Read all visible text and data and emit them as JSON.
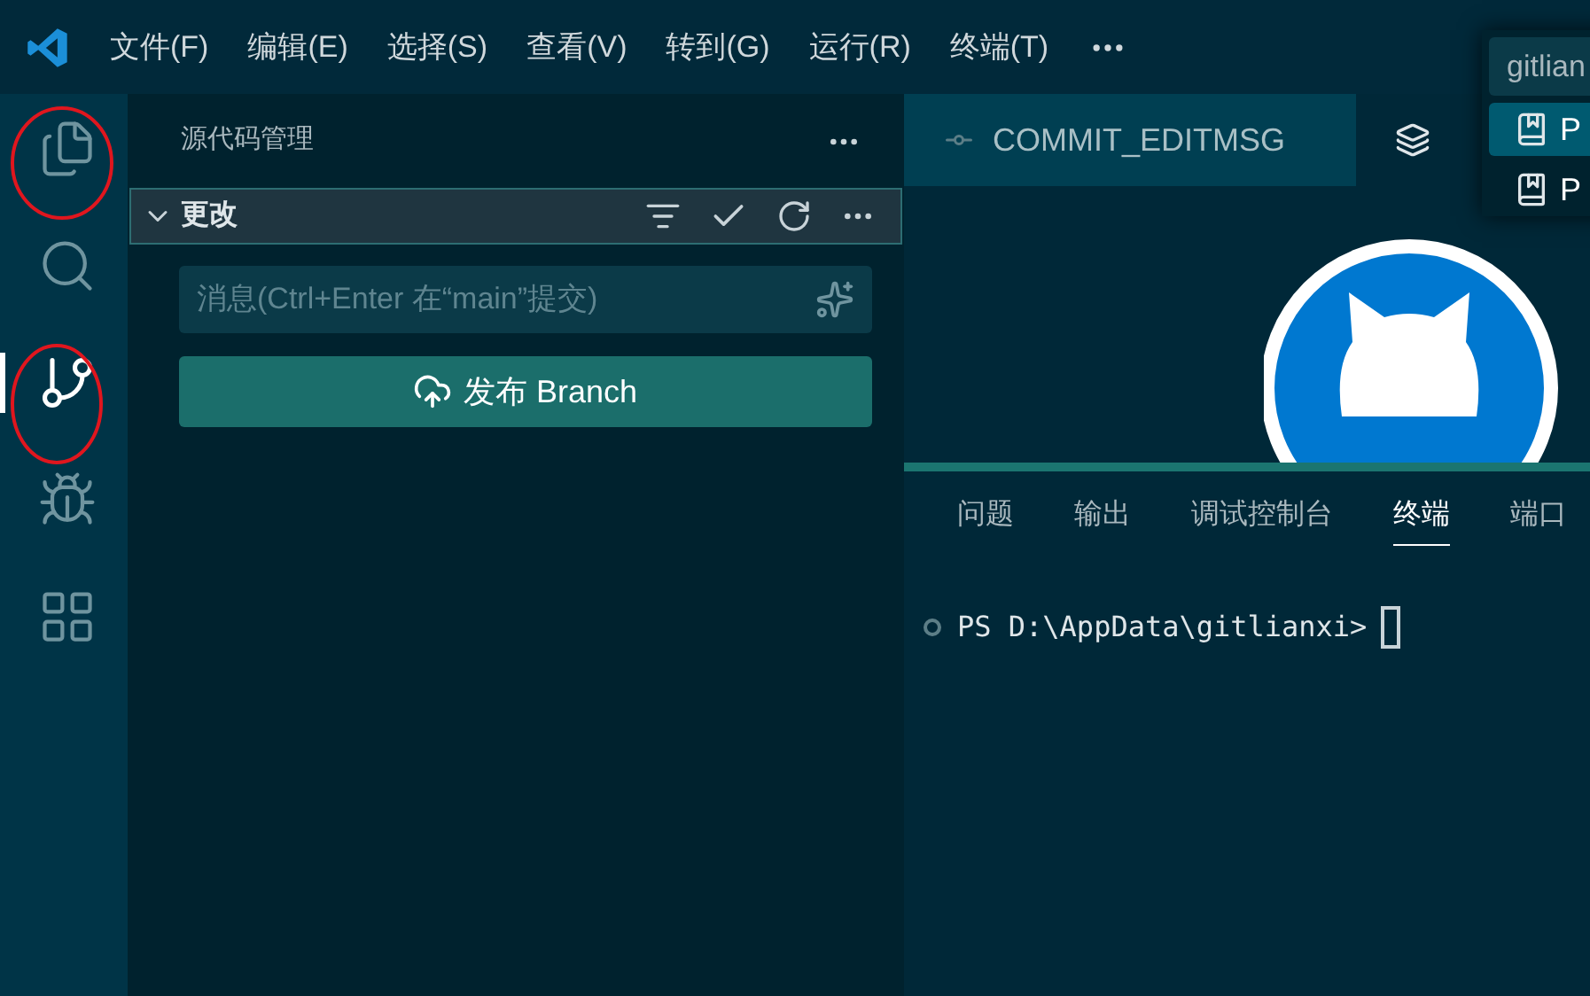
{
  "menu_bar": {
    "items": [
      "文件(F)",
      "编辑(E)",
      "选择(S)",
      "查看(V)",
      "转到(G)",
      "运行(R)",
      "终端(T)"
    ]
  },
  "activity_bar": {
    "items": [
      {
        "kind": "explorer",
        "selected": false
      },
      {
        "kind": "search",
        "selected": false
      },
      {
        "kind": "scm",
        "selected": true
      },
      {
        "kind": "debug",
        "selected": false
      },
      {
        "kind": "extensions",
        "selected": false
      }
    ]
  },
  "sidebar": {
    "title": "源代码管理",
    "section": {
      "title": "更改",
      "expanded": true
    },
    "message_field": {
      "placeholder": "消息(Ctrl+Enter 在“main”提交)"
    },
    "publish_button": "发布 Branch"
  },
  "editor_tabs": [
    {
      "label": "COMMIT_EDITMSG",
      "selected": true
    }
  ],
  "quick_pick": {
    "value": "gitlian",
    "items": [
      {
        "label": "P",
        "selected": true
      },
      {
        "label": "P",
        "selected": false
      }
    ]
  },
  "panel": {
    "tabs": [
      {
        "label": "问题",
        "selected": false
      },
      {
        "label": "输出",
        "selected": false
      },
      {
        "label": "调试控制台",
        "selected": false
      },
      {
        "label": "终端",
        "selected": true
      },
      {
        "label": "端口",
        "selected": false
      }
    ],
    "terminal": {
      "prompt": "PS D:\\AppData\\gitlianxi>"
    }
  }
}
